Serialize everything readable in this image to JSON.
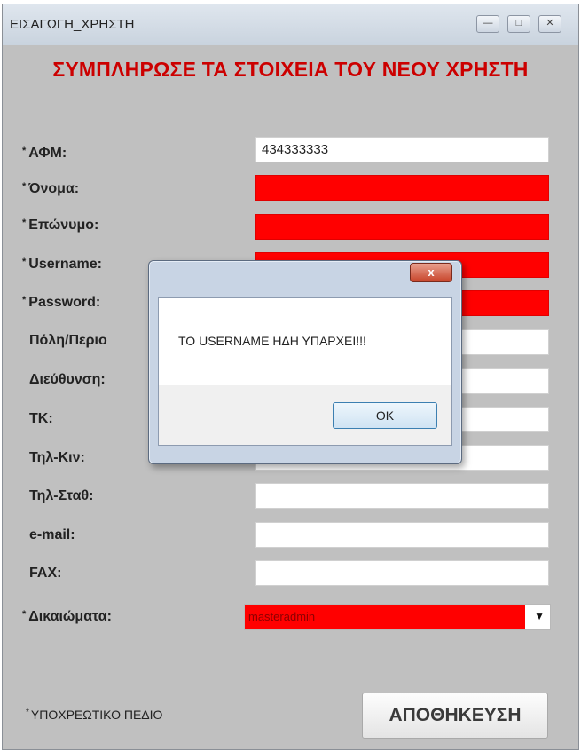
{
  "window": {
    "title": "ΕΙΣΑΓΩΓΗ_ΧΡΗΣΤΗ",
    "minimize_icon": "minimize-icon",
    "maximize_icon": "maximize-icon",
    "close_icon": "close-icon"
  },
  "form": {
    "heading": "ΣΥΜΠΛΗΡΩΣΕ ΤΑ ΣΤΟΙΧΕΙΑ ΤΟΥ ΝΕΟΥ ΧΡΗΣΤΗ",
    "required_mark": "*",
    "fields": [
      {
        "label": "ΑΦΜ:",
        "required": true,
        "value": "434333333",
        "error": false
      },
      {
        "label": "Όνομα:",
        "required": true,
        "value": "",
        "error": true
      },
      {
        "label": "Επώνυμο:",
        "required": true,
        "value": "",
        "error": true
      },
      {
        "label": "Username:",
        "required": true,
        "value": "",
        "error": true
      },
      {
        "label": "Password:",
        "required": true,
        "value": "",
        "error": true
      },
      {
        "label": "Πόλη/Περιο",
        "required": false,
        "value": "",
        "error": false
      },
      {
        "label": "Διεύθυνση:",
        "required": false,
        "value": "",
        "error": false
      },
      {
        "label": "ΤΚ:",
        "required": false,
        "value": "",
        "error": false
      },
      {
        "label": "Τηλ-Κιν:",
        "required": false,
        "value": "",
        "error": false
      },
      {
        "label": "Τηλ-Σταθ:",
        "required": false,
        "value": "",
        "error": false
      },
      {
        "label": "e-mail:",
        "required": false,
        "value": "",
        "error": false
      },
      {
        "label": "FAX:",
        "required": false,
        "value": "",
        "error": false
      }
    ],
    "rights": {
      "label": "Δικαιώματα:",
      "required": true,
      "selected": "masteradmin",
      "arrow": "▼"
    },
    "mandatory_note": "ΥΠΟΧΡΕΩΤΙΚΟ ΠΕΔΙΟ",
    "save_label": "ΑΠΟΘΗΚΕΥΣΗ"
  },
  "dialog": {
    "message": "ΤΟ USERNAME ΗΔΗ ΥΠΑΡΧΕΙ!!!",
    "ok_label": "OK",
    "close_glyph": "x"
  },
  "colors": {
    "error_fill": "#ff0000",
    "heading": "#cc0000",
    "window_bg": "#c0c0c0"
  }
}
